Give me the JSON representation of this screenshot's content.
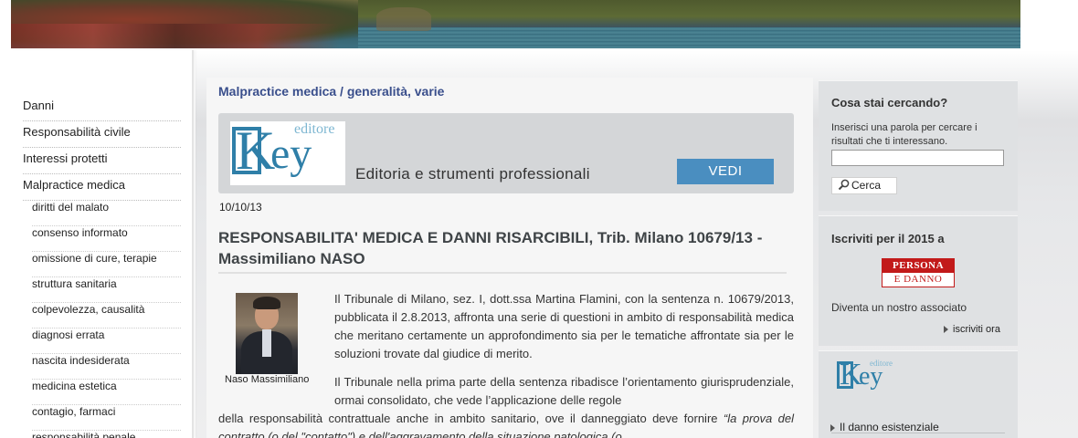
{
  "colors": {
    "accent_blue": "#3a4f8c",
    "button_blue": "#4a8ec0",
    "key_blue": "#2f7fa8",
    "persona_red": "#c21a1a",
    "sidebar_bg": "#dfe1e3"
  },
  "nav": {
    "items": [
      {
        "label": "Danni",
        "level": 1
      },
      {
        "label": "Responsabilità civile",
        "level": 1
      },
      {
        "label": "Interessi protetti",
        "level": 1
      },
      {
        "label": "Malpractice medica",
        "level": 1
      },
      {
        "label": "diritti del malato",
        "level": 2
      },
      {
        "label": "consenso informato",
        "level": 2
      },
      {
        "label": "omissione di cure, terapie",
        "level": 2
      },
      {
        "label": "struttura sanitaria",
        "level": 2
      },
      {
        "label": "colpevolezza, causalità",
        "level": 2
      },
      {
        "label": "diagnosi errata",
        "level": 2
      },
      {
        "label": "nascita indesiderata",
        "level": 2
      },
      {
        "label": "medicina estetica",
        "level": 2
      },
      {
        "label": "contagio, farmaci",
        "level": 2
      },
      {
        "label": "responsabilità penale",
        "level": 2
      }
    ]
  },
  "breadcrumb": "Malpractice medica / generalità, varie",
  "banner": {
    "logo_k": "K",
    "logo_ey": "ey",
    "logo_editore": "editore",
    "tagline": "Editoria e strumenti professionali",
    "button_label": "VEDI"
  },
  "article": {
    "date": "10/10/13",
    "title": "RESPONSABILITA' MEDICA E DANNI RISARCIBILI, Trib. Milano 10679/13 - Massimiliano NASO",
    "author_caption": "Naso Massimiliano",
    "para1": "Il Tribunale di Milano, sez. I, dott.ssa Martina Flamini, con la sentenza n. 10679/2013, pubblicata il 2.8.2013, affronta una serie di questioni in ambito di responsabilità medica che meritano certamente un approfondimento sia per le tematiche affrontate sia per le soluzioni trovate dal giudice di merito.",
    "para2_start": "Il Tribunale nella prima parte della sentenza ribadisce l’orientamento giurisprudenziale, ormai consolidato, che vede l’applicazione delle regole",
    "para2_cont": "della responsabilità contrattuale anche in ambito sanitario, ove il danneggiato deve fornire",
    "para2_italic": "“la prova del contratto (o del \"contatto\") e dell'aggravamento della situazione patologica (o"
  },
  "sidebar": {
    "search": {
      "title": "Cosa stai cercando?",
      "description": "Inserisci una parola per cercare i risultati che ti interessano.",
      "input_value": "",
      "button_label": "Cerca"
    },
    "subscribe": {
      "title": "Iscriviti per il 2015 a",
      "logo_line1": "PERSONA",
      "logo_line2": "E DANNO",
      "text": "Diventa un nostro associato",
      "link_label": "iscriviti ora"
    },
    "key_box": {
      "logo_k": "K",
      "logo_ey": "ey",
      "logo_editore": "editore",
      "link_label": "Il danno esistenziale"
    }
  }
}
